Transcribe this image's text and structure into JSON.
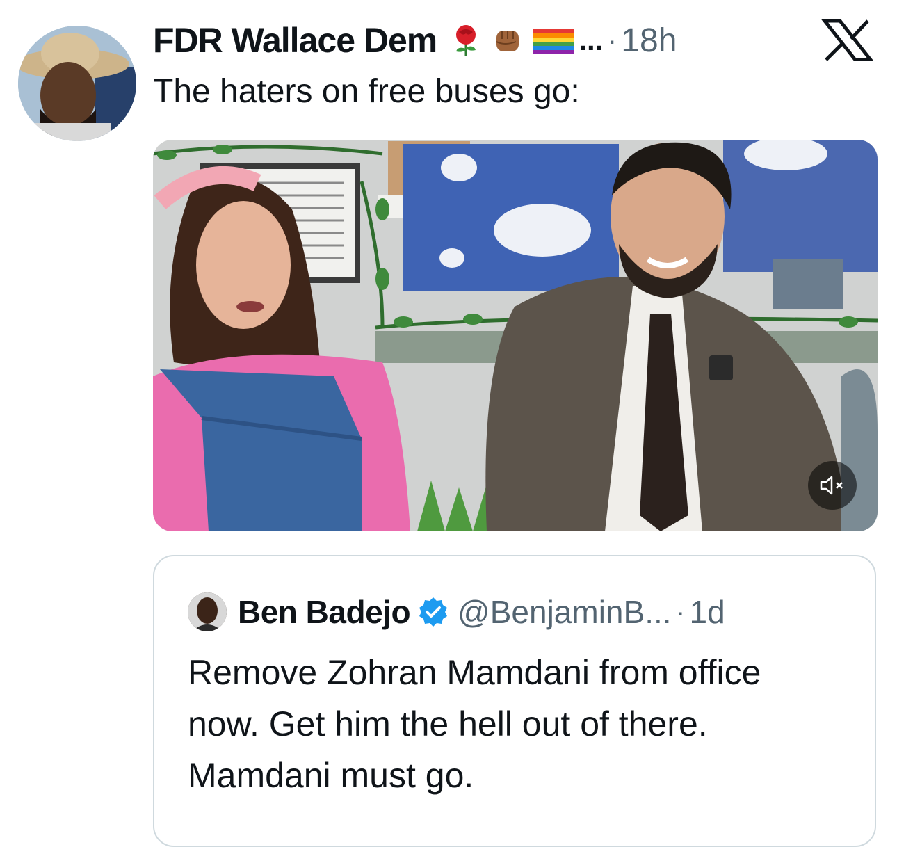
{
  "tweet": {
    "author_name": "FDR Wallace Dem",
    "emojis": [
      "rose-emoji",
      "raised-fist-emoji",
      "rainbow-flag-emoji"
    ],
    "ellipsis": "...",
    "separator": "·",
    "time": "18h",
    "text": "The haters on free buses go:"
  },
  "media": {
    "mute_icon": "speaker-muted-icon"
  },
  "quote": {
    "author_name": "Ben Badejo",
    "handle": "@BenjaminB...",
    "separator": "·",
    "time": "1d",
    "text_lines": [
      "Remove Zohran Mamdani from office",
      "now. Get him the hell out of there.",
      "Mamdani must go."
    ]
  },
  "colors": {
    "text": "#0f1419",
    "secondary": "#536471",
    "border": "#cfd9de",
    "verified": "#1d9bf0"
  }
}
